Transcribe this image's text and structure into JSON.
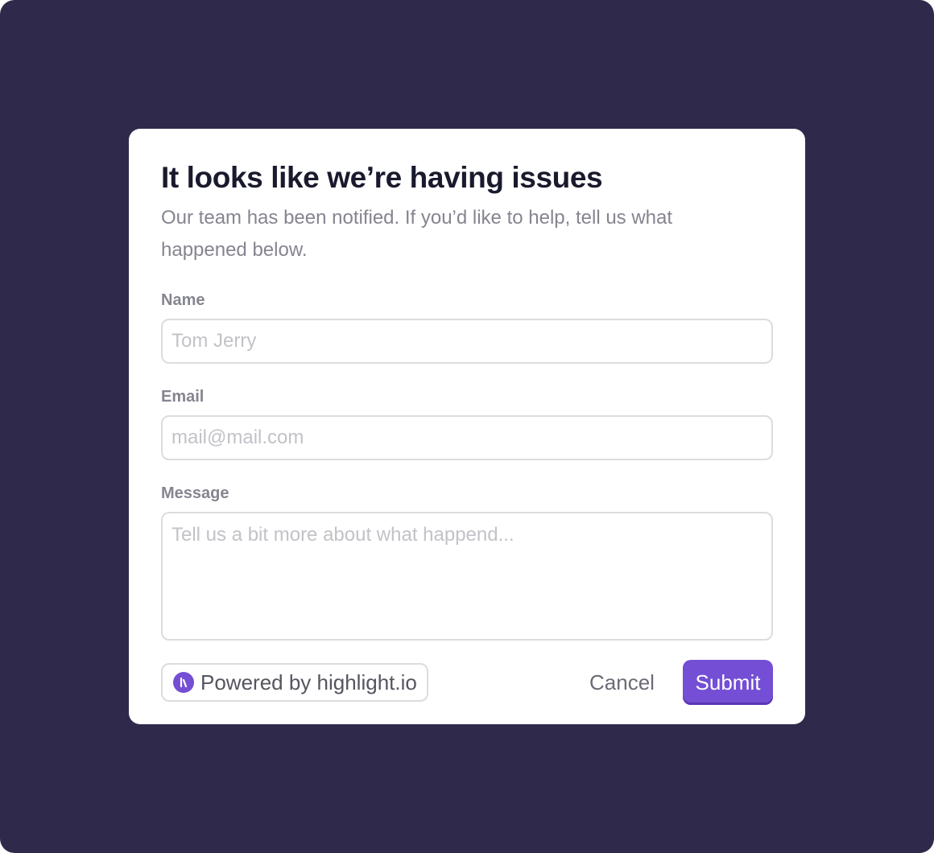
{
  "dialog": {
    "title": "It looks like we’re having issues",
    "subtitle": "Our team has been notified. If you’d like to help, tell us what happened below."
  },
  "form": {
    "name": {
      "label": "Name",
      "placeholder": "Tom Jerry"
    },
    "email": {
      "label": "Email",
      "placeholder": "mail@mail.com"
    },
    "message": {
      "label": "Message",
      "placeholder": "Tell us a bit more about what happend..."
    }
  },
  "footer": {
    "powered_by": "Powered by highlight.io",
    "powered_icon": "highlight-logo-icon",
    "cancel_label": "Cancel",
    "submit_label": "Submit"
  },
  "colors": {
    "backdrop": "#2f294c",
    "accent": "#744ed4"
  }
}
